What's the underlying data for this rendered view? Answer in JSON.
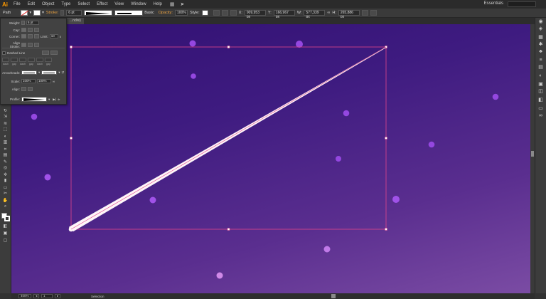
{
  "app": {
    "logo": "Ai"
  },
  "menu": {
    "items": [
      "File",
      "Edit",
      "Object",
      "Type",
      "Select",
      "Effect",
      "View",
      "Window",
      "Help"
    ]
  },
  "workspace": {
    "label": "Essentials"
  },
  "control": {
    "object_type": "Path",
    "stroke_label": "Stroke:",
    "stroke_weight": "6 pt",
    "brush_label": "Basic",
    "opacity_label": "Opacity:",
    "opacity_value": "100%",
    "style_label": "Style:",
    "x_value": "909,953 px",
    "y_value": "166,967 px",
    "w_value": "577,339 px",
    "h_value": "265,886 px"
  },
  "document": {
    "tab": "...ndre)"
  },
  "stroke_panel": {
    "weight_label": "Weight:",
    "weight_value": "6 pt",
    "cap_label": "Cap:",
    "corner_label": "Corner:",
    "limit_label": "Limit:",
    "limit_value": "10",
    "align_label": "Align Stroke:",
    "dashed_label": "Dashed Line",
    "dash_labels": [
      "dash",
      "gap",
      "dash",
      "gap",
      "dash",
      "gap"
    ],
    "arrowheads_label": "Arrowheads:",
    "scale_label": "Scale:",
    "scale_start": "100%",
    "scale_end": "100%",
    "align_arrow_label": "Align:",
    "profile_label": "Profile:"
  },
  "status": {
    "zoom": "400%",
    "page": "1",
    "mode": "Selection"
  },
  "colors": {
    "canvas_top": "#311072",
    "canvas_bottom": "#7b4ca4",
    "dot": "#9447e0",
    "selection": "#e0458a",
    "stroke": "#ffffff"
  }
}
